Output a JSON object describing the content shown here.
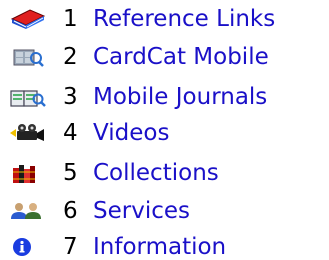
{
  "menu": {
    "accent_color": "#1a10c8",
    "items": [
      {
        "number": "1",
        "label": "Reference Links",
        "icon": "book-icon"
      },
      {
        "number": "2",
        "label": "CardCat Mobile",
        "icon": "card-catalog-icon"
      },
      {
        "number": "3",
        "label": "Mobile Journals",
        "icon": "journals-search-icon"
      },
      {
        "number": "4",
        "label": "Videos",
        "icon": "video-camera-icon"
      },
      {
        "number": "5",
        "label": "Collections",
        "icon": "books-icon"
      },
      {
        "number": "6",
        "label": "Services",
        "icon": "people-icon"
      },
      {
        "number": "7",
        "label": "Information",
        "icon": "info-icon"
      }
    ]
  }
}
